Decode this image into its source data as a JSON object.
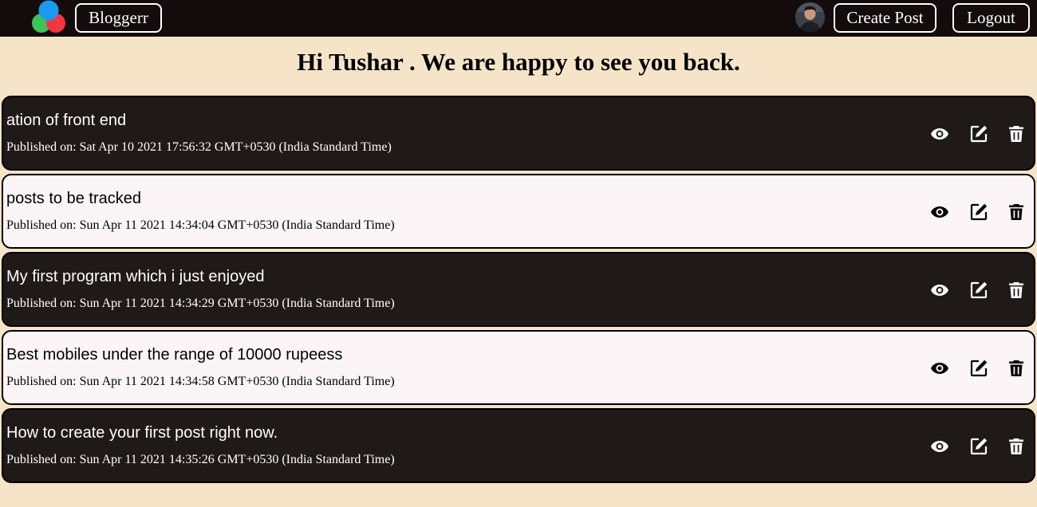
{
  "nav": {
    "brand": "Bloggerr",
    "create_post": "Create Post",
    "logout": "Logout"
  },
  "greeting": "Hi Tushar . We are happy to see you back.",
  "posts": [
    {
      "title": "ation of front end",
      "published": "Published on: Sat Apr 10 2021 17:56:32 GMT+0530 (India Standard Time)",
      "theme": "dark"
    },
    {
      "title": "posts to be tracked",
      "published": "Published on: Sun Apr 11 2021 14:34:04 GMT+0530 (India Standard Time)",
      "theme": "light"
    },
    {
      "title": "My first program which i just enjoyed",
      "published": "Published on: Sun Apr 11 2021 14:34:29 GMT+0530 (India Standard Time)",
      "theme": "dark"
    },
    {
      "title": "Best mobiles under the range of 10000 rupeess",
      "published": "Published on: Sun Apr 11 2021 14:34:58 GMT+0530 (India Standard Time)",
      "theme": "light"
    },
    {
      "title": "How to create your first post right now.",
      "published": "Published on: Sun Apr 11 2021 14:35:26 GMT+0530 (India Standard Time)",
      "theme": "dark"
    }
  ],
  "icons": {
    "view": "eye-icon",
    "edit": "edit-icon",
    "delete": "trash-icon"
  },
  "colors": {
    "navbar": "#140c0c",
    "page_background": "#f5e4c7",
    "dark_card": "#1f1a17",
    "light_card": "#fbf5f8",
    "logo_blue": "#1a9bf0",
    "logo_green": "#3cc35a",
    "logo_red": "#f2363f"
  }
}
